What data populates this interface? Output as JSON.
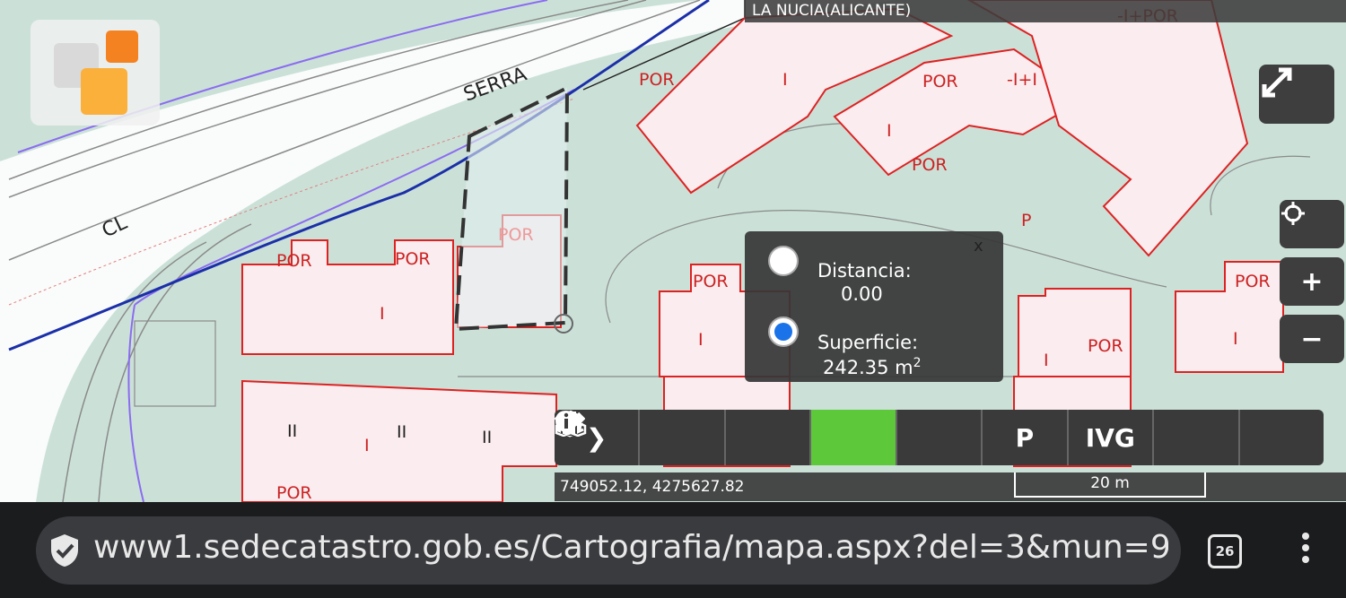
{
  "map": {
    "region_label": "LA NUCIA(ALICANTE)",
    "street_labels": [
      "SERRA",
      "CL"
    ],
    "parcel_labels": [
      "POR",
      "POR",
      "POR",
      "POR",
      "POR",
      "POR",
      "POR",
      "POR",
      "POR",
      "POR",
      "I",
      "I",
      "I",
      "I",
      "I",
      "I",
      "I",
      "-I+I",
      "II",
      "II",
      "II",
      "P",
      "-I+POR"
    ]
  },
  "controls": {
    "fullscreen_icon": "expand-icon",
    "locate_icon": "crosshair-icon",
    "zoom_in": "+",
    "zoom_out": "−"
  },
  "measure": {
    "close": "x",
    "distance_label": "Distancia:",
    "distance_value": "0.00",
    "area_label": "Superficie:",
    "area_value": "242.35 m",
    "area_unit_sup": "2",
    "selected": "area"
  },
  "toolbar": {
    "items": [
      {
        "name": "expand-chevron-icon",
        "glyph": "❯"
      },
      {
        "name": "search-icon",
        "glyph": "🔍"
      },
      {
        "name": "layers-icon",
        "glyph": "≋"
      },
      {
        "name": "measure-icon",
        "glyph": "⟷"
      },
      {
        "name": "print-icon",
        "glyph": "⎙"
      },
      {
        "name": "parcel-pointer-icon",
        "glyph": "P"
      },
      {
        "name": "ivg-icon",
        "glyph": "IVG"
      },
      {
        "name": "cubes-icon",
        "glyph": "⬢"
      },
      {
        "name": "info-icon",
        "glyph": "ℹ"
      }
    ],
    "active_index": 3,
    "active_color": "#5cc83a"
  },
  "status": {
    "coordinates": "749052.12, 4275627.82",
    "scale_label": "20 m"
  },
  "browser": {
    "url": "www1.sedecatastro.gob.es/Cartografia/mapa.aspx?del=3&mun=948",
    "tab_count": "26"
  }
}
